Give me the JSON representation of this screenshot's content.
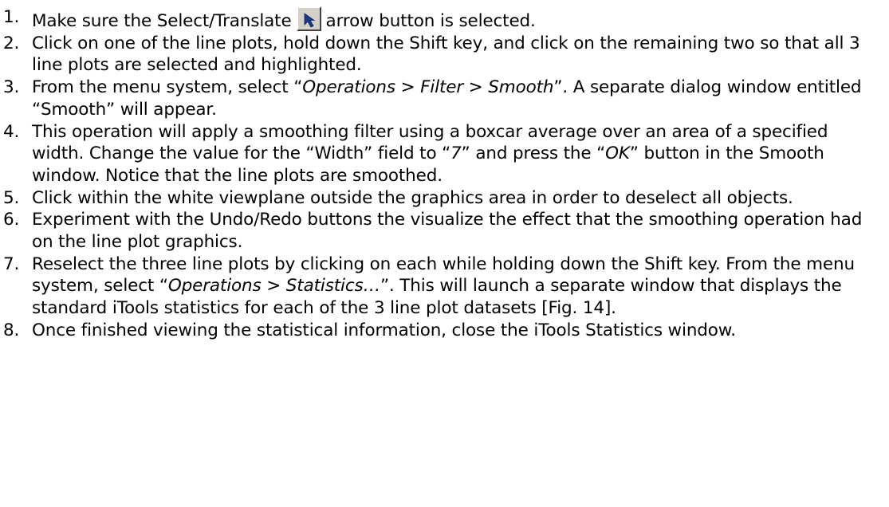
{
  "steps": [
    {
      "num": "1.",
      "a": "Make sure the Select/Translate",
      "icon": "select-translate-arrow-icon",
      "b": "arrow button is selected."
    },
    {
      "num": "2.",
      "text": "Click on one of the line plots, hold down the Shift key, and click on the remaining two so that all 3 line plots are selected and highlighted."
    },
    {
      "num": "3.",
      "a": "From the menu system, select “",
      "menu": "Operations > Filter > Smooth",
      "b": "”.  A separate dialog window entitled “Smooth” will appear."
    },
    {
      "num": "4.",
      "a": "This operation will apply a smoothing filter using a boxcar average over an area of a specified width.  Change the value for the “Width” field to “",
      "value": "7",
      "b": "” and press the “",
      "button": "OK",
      "c": "” button in the Smooth window.  Notice that the line plots are smoothed."
    },
    {
      "num": "5.",
      "text": "Click within the white viewplane outside the graphics area in order to deselect all objects."
    },
    {
      "num": "6.",
      "text": "Experiment with the Undo/Redo buttons the visualize the effect that the smoothing operation had on the line plot graphics."
    },
    {
      "num": "7.",
      "a": "Reselect the three line plots by clicking on each while holding down the Shift key.  From the menu system, select “",
      "menu": "Operations > Statistics…",
      "b": "”.  This will launch a separate window that displays the standard iTools statistics for each of the 3 line plot datasets [Fig. 14]."
    },
    {
      "num": "8.",
      "text": "Once finished viewing the statistical information, close the iTools Statistics window."
    }
  ],
  "colors": {
    "text": "#000000",
    "button_face": "#d4d0c8",
    "arrow_icon": "#1a3a8c"
  }
}
